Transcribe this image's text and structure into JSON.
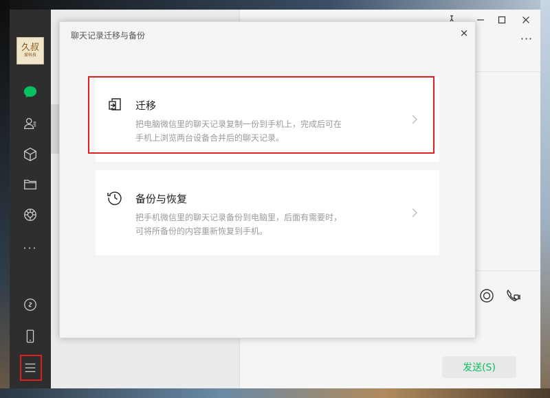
{
  "sidebar": {
    "avatar_text_main": "久叔",
    "avatar_text_sub": "爱科技",
    "icons": [
      "chat-icon",
      "contacts-icon",
      "box-icon",
      "folder-icon",
      "shutter-icon",
      "more-icon",
      "link-icon",
      "phone-icon",
      "menu-icon"
    ]
  },
  "window": {
    "controls": [
      "pin-icon",
      "minimize-icon",
      "maximize-icon",
      "close-icon"
    ],
    "more_label": "···"
  },
  "dialog": {
    "title": "聊天记录迁移与备份",
    "close_label": "×",
    "options": [
      {
        "title": "迁移",
        "description_line1": "把电脑微信里的聊天记录复制一份到手机上，完成后可在",
        "description_line2": "手机上浏览两台设备合并后的聊天记录。",
        "icon": "migrate-icon"
      },
      {
        "title": "备份与恢复",
        "description_line1": "把手机微信里的聊天记录备份到电脑里，后面有需要时，",
        "description_line2": "可将所备份的内容重新恢复到手机。",
        "icon": "history-icon"
      }
    ]
  },
  "chat": {
    "send_label": "发送(S)"
  },
  "colors": {
    "accent": "#07c160",
    "highlight": "#e02020",
    "sidebar_bg": "#2e2e2e"
  }
}
